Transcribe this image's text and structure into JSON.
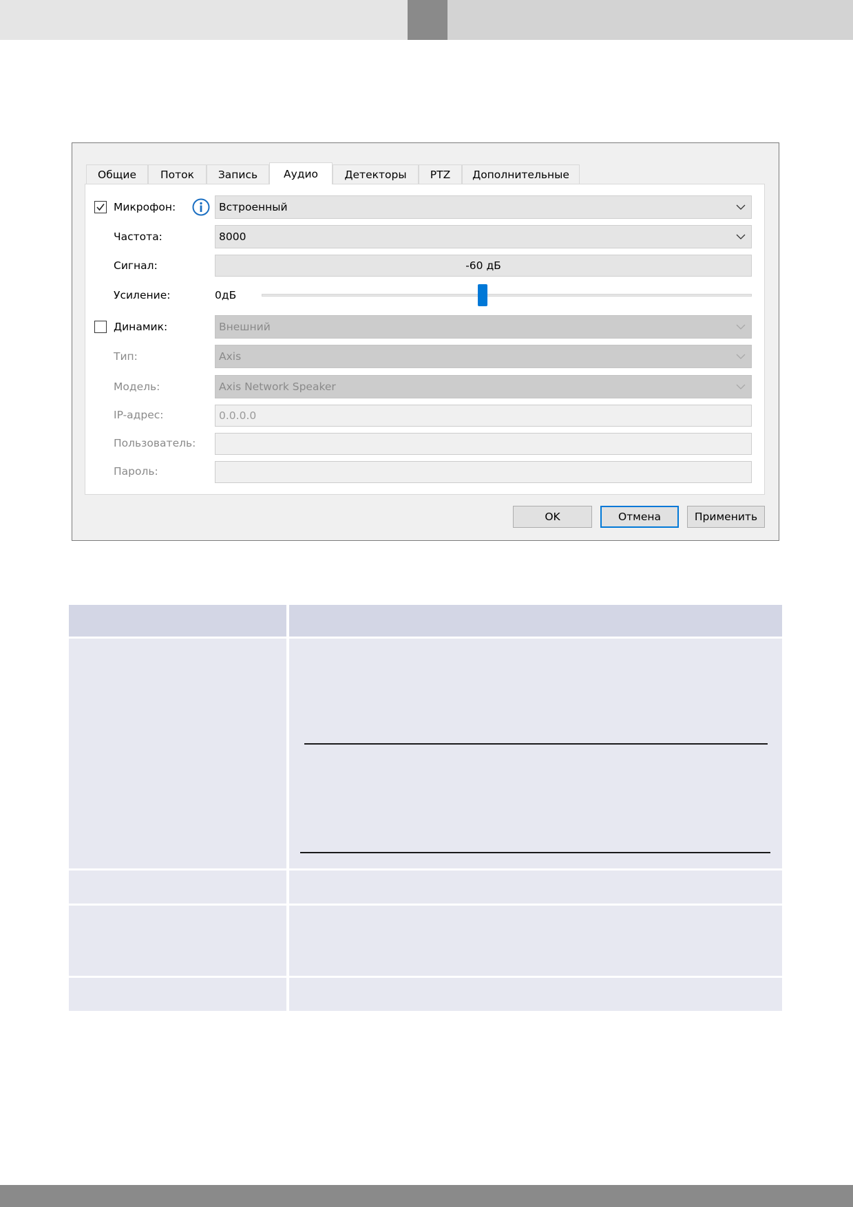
{
  "dialog": {
    "tabs": [
      {
        "label": "Общие"
      },
      {
        "label": "Поток"
      },
      {
        "label": "Запись"
      },
      {
        "label": "Аудио"
      },
      {
        "label": "Детекторы"
      },
      {
        "label": "PTZ"
      },
      {
        "label": "Дополнительные"
      }
    ],
    "active_tab": "Аудио",
    "microphone": {
      "label": "Микрофон:",
      "checked": true,
      "value": "Встроенный"
    },
    "frequency": {
      "label": "Частота:",
      "value": "8000"
    },
    "signal": {
      "label": "Сигнал:",
      "value": "-60 дБ"
    },
    "gain": {
      "label": "Усиление:",
      "value": "0дБ",
      "slider_fraction": 0.45
    },
    "speaker": {
      "label": "Динамик:",
      "checked": false,
      "value": "Внешний"
    },
    "type": {
      "label": "Тип:",
      "value": "Axis"
    },
    "model": {
      "label": "Модель:",
      "value": "Axis Network Speaker"
    },
    "ip": {
      "label": "IP-адрес:",
      "value": "0.0.0.0"
    },
    "user": {
      "label": "Пользователь:",
      "value": ""
    },
    "password": {
      "label": "Пароль:",
      "value": ""
    },
    "buttons": {
      "ok": "OK",
      "cancel": "Отмена",
      "apply": "Применить"
    }
  },
  "colors": {
    "accent": "#0078d7",
    "header_band": "#e5e5e5",
    "header_dark": "#8a8a8a",
    "table_head": "#d3d6e5",
    "table_body": "#e7e8f1"
  }
}
